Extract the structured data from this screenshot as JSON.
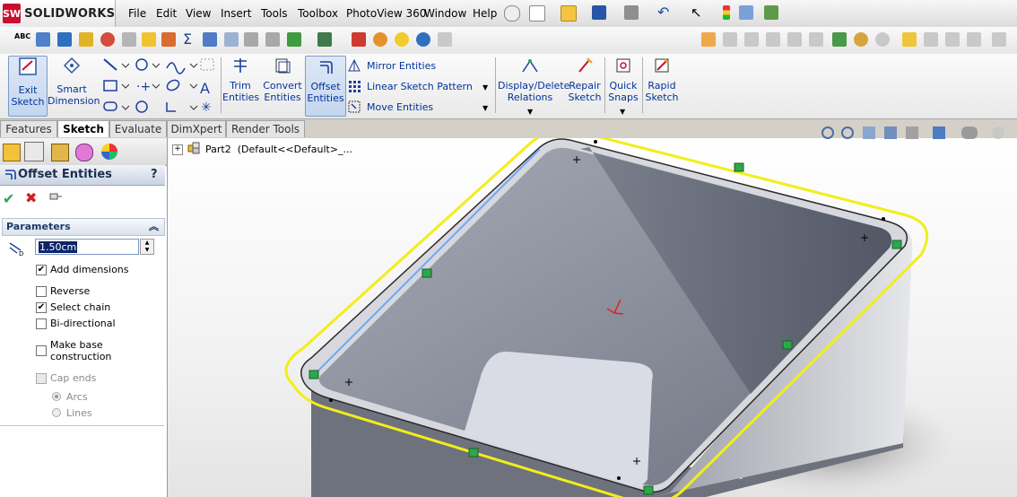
{
  "app": {
    "name": "SOLIDWORKS",
    "logo_badge": "SW"
  },
  "menu": [
    "File",
    "Edit",
    "View",
    "Insert",
    "Tools",
    "Toolbox",
    "PhotoView 360",
    "Window",
    "Help"
  ],
  "command_manager": {
    "exit_sketch": "Exit\nSketch",
    "smart_dimension": "Smart\nDimension",
    "trim_entities": "Trim\nEntities",
    "convert_entities": "Convert\nEntities",
    "offset_entities": "Offset\nEntities",
    "mirror_entities": "Mirror Entities",
    "linear_sketch_pattern": "Linear Sketch Pattern",
    "move_entities": "Move Entities",
    "display_delete_relations": "Display/Delete\nRelations",
    "repair_sketch": "Repair\nSketch",
    "quick_snaps": "Quick\nSnaps",
    "rapid_sketch": "Rapid\nSketch"
  },
  "tabs": [
    "Features",
    "Sketch",
    "Evaluate",
    "DimXpert",
    "Render Tools"
  ],
  "active_tab": "Sketch",
  "tree": {
    "part": "Part2  (Default<<Default>_..."
  },
  "property_manager": {
    "title": "Offset Entities",
    "help": "?",
    "section": "Parameters",
    "distance_value": "1.50cm",
    "options": [
      {
        "label": "Add dimensions",
        "checked": true,
        "enabled": true
      },
      {
        "label": "Reverse",
        "checked": false,
        "enabled": true
      },
      {
        "label": "Select chain",
        "checked": true,
        "enabled": true
      },
      {
        "label": "Bi-directional",
        "checked": false,
        "enabled": true
      },
      {
        "label": "Make base\nconstruction",
        "checked": false,
        "enabled": true
      },
      {
        "label": "Cap ends",
        "checked": false,
        "enabled": false
      }
    ],
    "cap_types": [
      {
        "label": "Arcs",
        "selected": true
      },
      {
        "label": "Lines",
        "selected": false
      }
    ]
  },
  "colors": {
    "accent": "#003399",
    "offset_preview": "#f2ee1a",
    "model_face": "#7d8290",
    "relation_marker": "#2aa84a"
  }
}
